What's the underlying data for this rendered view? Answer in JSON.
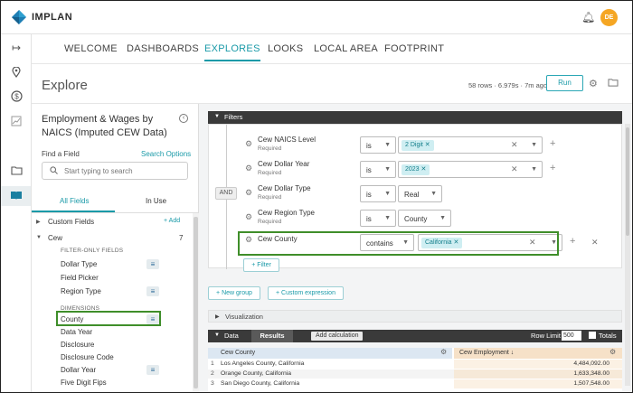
{
  "app": {
    "name": "IMPLAN",
    "avatar_initials": "DE"
  },
  "colors": {
    "accent": "#1a9aa8",
    "highlight": "#3f8e2a",
    "avatar": "#f5a623",
    "section_bar": "#3a3a3a"
  },
  "rail_icons": [
    "arrow-right-to-line-icon",
    "map-pin-icon",
    "dollar-circle-icon",
    "chart-line-icon",
    "folder-icon",
    "open-book-icon"
  ],
  "nav": {
    "tabs": [
      "WELCOME",
      "DASHBOARDS",
      "EXPLORES",
      "LOOKS",
      "LOCAL AREA",
      "FOOTPRINT"
    ],
    "active": "EXPLORES"
  },
  "explore": {
    "title": "Explore",
    "row_info": "58 rows · 6.979s · 7m ago",
    "run_label": "Run"
  },
  "field_picker": {
    "model_title": "Employment & Wages by NAICS (Imputed CEW Data)",
    "find_label": "Find a Field",
    "search_options": "Search Options",
    "search_placeholder": "Start typing to search",
    "tab_all": "All Fields",
    "tab_in_use": "In Use",
    "custom_fields": "Custom Fields",
    "add_label": "+ Add",
    "group_cew": "Cew",
    "group_cew_count": "7",
    "filter_only_heading": "FILTER-ONLY FIELDS",
    "filter_only": [
      "Dollar Type",
      "Field Picker",
      "Region Type"
    ],
    "dimensions_heading": "DIMENSIONS",
    "dimensions": [
      "County",
      "Data Year",
      "Disclosure",
      "Disclosure Code",
      "Dollar Year",
      "Five Digit Fips"
    ]
  },
  "filters": {
    "section_title": "Filters",
    "and_label": "AND",
    "rules": [
      {
        "name": "Cew NAICS Level",
        "required": "Required",
        "op": "is",
        "value": "2 Digit"
      },
      {
        "name": "Cew Dollar Year",
        "required": "Required",
        "op": "is",
        "value": "2023"
      },
      {
        "name": "Cew Dollar Type",
        "required": "Required",
        "op": "is",
        "value": "Real"
      },
      {
        "name": "Cew Region Type",
        "required": "Required",
        "op": "is",
        "value": "County"
      },
      {
        "name": "Cew County",
        "required": "",
        "op": "contains",
        "value": "California"
      }
    ],
    "add_filter": "+ Filter",
    "new_group": "+ New group",
    "custom_expression": "+ Custom expression"
  },
  "visualization": {
    "title": "Visualization"
  },
  "data": {
    "title": "Data",
    "results_tab": "Results",
    "add_calculation": "Add calculation",
    "row_limit_label": "Row Limit",
    "row_limit": "500",
    "totals_label": "Totals",
    "columns": [
      "Cew County",
      "Cew Employment ↓"
    ],
    "rows": [
      {
        "n": "1",
        "county": "Los Angeles County, California",
        "employment": "4,484,092.00"
      },
      {
        "n": "2",
        "county": "Orange County, California",
        "employment": "1,633,348.00"
      },
      {
        "n": "3",
        "county": "San Diego County, California",
        "employment": "1,507,548.00"
      }
    ]
  }
}
